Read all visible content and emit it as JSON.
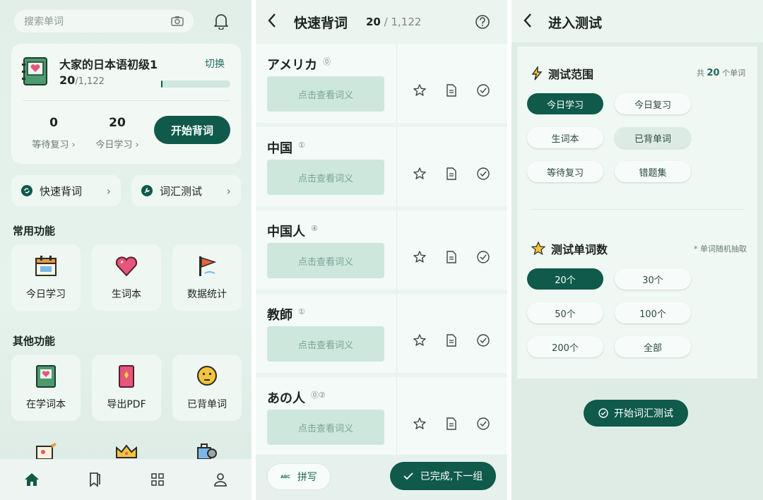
{
  "panel1": {
    "search_placeholder": "搜索单词",
    "book": {
      "title": "大家的日本语初级1",
      "learned": "20",
      "total": "/1,122",
      "switch_label": "切换",
      "progress": 0.018
    },
    "stats": [
      {
        "value": "0",
        "label": "等待复习 ›"
      },
      {
        "value": "20",
        "label": "今日学习 ›"
      }
    ],
    "start_label": "开始背词",
    "quick": [
      {
        "label": "快速背词"
      },
      {
        "label": "词汇测试"
      }
    ],
    "common_title": "常用功能",
    "common": [
      {
        "label": "今日学习"
      },
      {
        "label": "生词本"
      },
      {
        "label": "数据统计"
      }
    ],
    "other_title": "其他功能",
    "other": [
      {
        "label": "在学词本"
      },
      {
        "label": "导出PDF"
      },
      {
        "label": "已背单词"
      }
    ]
  },
  "panel2": {
    "title": "快速背词",
    "count": "20",
    "total": " / 1,122",
    "words": [
      {
        "word": "アメリカ",
        "tone": "⓪",
        "reveal": "点击查看词义"
      },
      {
        "word": "中国",
        "tone": "①",
        "reveal": "点击查看词义"
      },
      {
        "word": "中国人",
        "tone": "④",
        "reveal": "点击查看词义"
      },
      {
        "word": "教師",
        "tone": "①",
        "reveal": "点击查看词义"
      },
      {
        "word": "あの人",
        "tone": "⓪②",
        "reveal": "点击查看词义"
      }
    ],
    "spell_label": "拼写",
    "spell_badge": "ABC",
    "done_label": "已完成,下一组"
  },
  "panel3": {
    "title": "进入测试",
    "range_title": "测试范围",
    "range_note_pre": "共 ",
    "range_note_num": "20",
    "range_note_post": " 个单词",
    "range_chips": [
      "今日学习",
      "今日复习",
      "生词本",
      "已背单词",
      "等待复习",
      "错题集"
    ],
    "count_title": "测试单词数",
    "count_note": "* 单词随机抽取",
    "count_chips": [
      "20个",
      "30个",
      "50个",
      "100个",
      "200个",
      "全部"
    ],
    "start_label": "开始词汇测试"
  },
  "colors": {
    "primary": "#0f5a4a",
    "accent": "#1e6b59",
    "reveal_bg": "#cde7dd"
  }
}
